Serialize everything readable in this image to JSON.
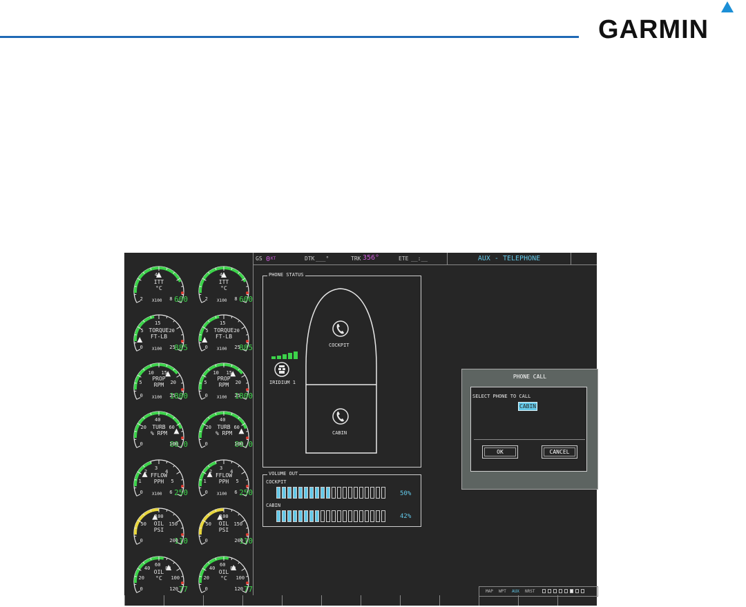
{
  "brand": {
    "logo": "GARMIN"
  },
  "display": {
    "navbar": {
      "gs_label": "GS",
      "gs_value": "0",
      "gs_unit": "KT",
      "dtk_label": "DTK",
      "dtk_value": "___°",
      "trk_label": "TRK",
      "trk_value": "356°",
      "ete_label": "ETE",
      "ete_value": "__:__"
    },
    "page_title": "AUX - TELEPHONE",
    "engine_gauges": [
      {
        "label": "ITT",
        "unit": "°C",
        "scale": "X100",
        "value": "600",
        "ticks": [
          "2",
          "4",
          "8"
        ]
      },
      {
        "label": "ITT",
        "unit": "°C",
        "scale": "X100",
        "value": "600",
        "ticks": [
          "2",
          "4",
          "8"
        ]
      },
      {
        "label": "TORQUE",
        "unit": "FT-LB",
        "scale": "X100",
        "value": "885",
        "ticks": [
          "0",
          "5",
          "15",
          "20",
          "25"
        ]
      },
      {
        "label": "TORQUE",
        "unit": "FT-LB",
        "scale": "X100",
        "value": "885",
        "ticks": [
          "0",
          "5",
          "15",
          "20",
          "25"
        ]
      },
      {
        "label": "PROP",
        "unit": "RPM",
        "scale": "X100",
        "value": "1800",
        "ticks": [
          "0",
          "5",
          "10",
          "15",
          "20",
          "25"
        ]
      },
      {
        "label": "PROP",
        "unit": "RPM",
        "scale": "X100",
        "value": "1800",
        "ticks": [
          "0",
          "5",
          "10",
          "15",
          "20",
          "25"
        ]
      },
      {
        "label": "TURB",
        "unit": "% RPM",
        "scale": "",
        "value": "80.0",
        "ticks": [
          "0",
          "20",
          "40",
          "60",
          "100"
        ]
      },
      {
        "label": "TURB",
        "unit": "% RPM",
        "scale": "",
        "value": "80.0",
        "ticks": [
          "0",
          "20",
          "40",
          "60",
          "100"
        ]
      },
      {
        "label": "FFLOW",
        "unit": "PPH",
        "scale": "X100",
        "value": "250",
        "ticks": [
          "0",
          "1",
          "2",
          "3",
          "4",
          "5",
          "6"
        ]
      },
      {
        "label": "FFLOW",
        "unit": "PPH",
        "scale": "X100",
        "value": "250",
        "ticks": [
          "0",
          "1",
          "2",
          "3",
          "4",
          "5",
          "6"
        ]
      },
      {
        "label": "OIL",
        "unit": "PSI",
        "scale": "",
        "value": "110",
        "ticks": [
          "0",
          "50",
          "100",
          "150",
          "200"
        ]
      },
      {
        "label": "OIL",
        "unit": "PSI",
        "scale": "",
        "value": "110",
        "ticks": [
          "0",
          "50",
          "100",
          "150",
          "200"
        ]
      },
      {
        "label": "OIL",
        "unit": "°C",
        "scale": "",
        "value": "77",
        "ticks": [
          "0",
          "20",
          "40",
          "60",
          "80",
          "100",
          "120"
        ]
      },
      {
        "label": "OIL",
        "unit": "°C",
        "scale": "",
        "value": "77",
        "ticks": [
          "0",
          "20",
          "40",
          "60",
          "80",
          "100",
          "120"
        ]
      }
    ],
    "phone_status": {
      "title": "PHONE STATUS",
      "iridium_label": "IRIDIUM 1",
      "signal_bars": 5,
      "cockpit_label": "COCKPIT",
      "cabin_label": "CABIN"
    },
    "volume_out": {
      "title": "VOLUME OUT",
      "channels": [
        {
          "label": "COCKPIT",
          "percent": "50%",
          "level": 0.5
        },
        {
          "label": "CABIN",
          "percent": "42%",
          "level": 0.42
        }
      ]
    },
    "dialog": {
      "title": "PHONE CALL",
      "prompt": "SELECT PHONE TO CALL",
      "selection": "CABIN",
      "ok": "OK",
      "cancel": "CANCEL"
    },
    "page_group": {
      "groups": [
        "MAP",
        "WPT",
        "AUX",
        "NRST"
      ],
      "active": "AUX"
    },
    "colors": {
      "bezel": "#262626",
      "cyan": "#63c8e8",
      "green": "#3cd34a",
      "magenta": "#d35ee0",
      "garmin_blue": "#1f69b5"
    }
  }
}
